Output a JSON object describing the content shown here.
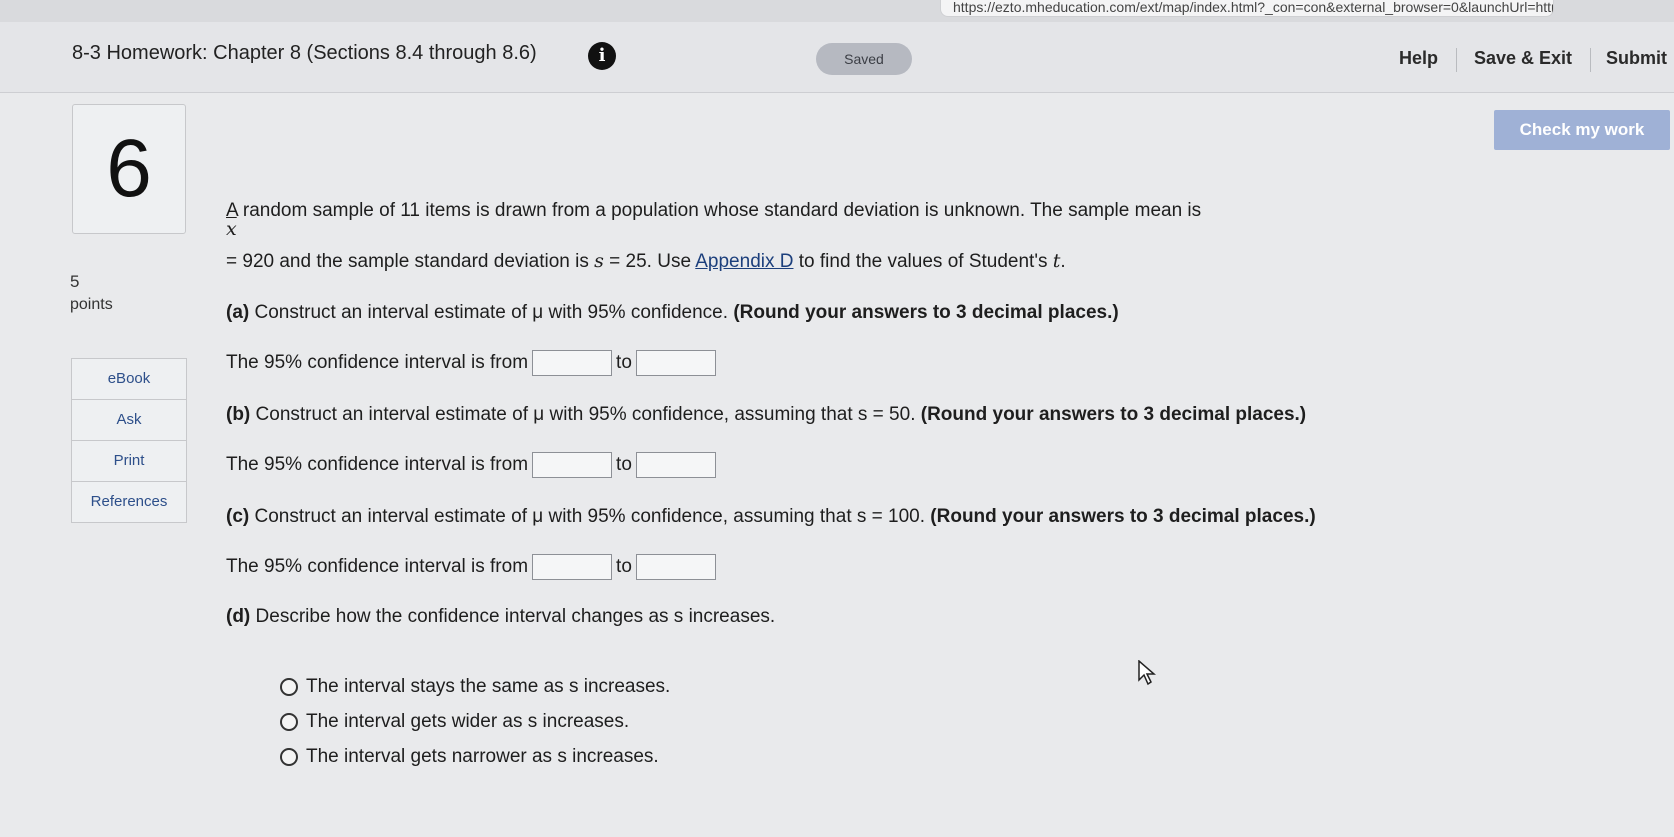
{
  "browser": {
    "url_fragment": "https://ezto.mheducation.com/ext/map/index.html?_con=con&external_browser=0&launchUrl=https%253A%252F%252Fnew..."
  },
  "header": {
    "title": "8-3 Homework: Chapter 8 (Sections 8.4 through 8.6)",
    "info_icon": "info-circle-icon",
    "status": "Saved",
    "help": "Help",
    "save_exit": "Save & Exit",
    "submit": "Submit"
  },
  "check_button": "Check my work",
  "question": {
    "number": "6",
    "points_value": "5",
    "points_label": "points",
    "nav": [
      "eBook",
      "Ask",
      "Print",
      "References"
    ],
    "intro_1": "A random sample of 11 items is drawn from a population whose standard deviation is unknown. The sample mean is",
    "xbar_symbol": "x",
    "intro_2a": "= 920 and the sample standard deviation is ",
    "s_symbol": "s",
    "intro_2b": " = 25. Use ",
    "appendix_link": "Appendix D",
    "intro_2c": " to find the values of Student's ",
    "t_symbol": "t",
    "intro_2d": ".",
    "parts": [
      {
        "label": "(a)",
        "text": " Construct an interval estimate of μ with 95% confidence. ",
        "instruction": "(Round your answers to 3 decimal places.)",
        "interval_prefix": "The 95% confidence interval is from",
        "interval_to": "to"
      },
      {
        "label": "(b)",
        "text": " Construct an interval estimate of μ with 95% confidence, assuming that s = 50. ",
        "instruction": "(Round your answers to 3 decimal places.)",
        "interval_prefix": "The 95% confidence interval is from",
        "interval_to": "to"
      },
      {
        "label": "(c)",
        "text": " Construct an interval estimate of μ with 95% confidence, assuming that s = 100. ",
        "instruction": "(Round your answers to 3 decimal places.)",
        "interval_prefix": "The 95% confidence interval is from",
        "interval_to": "to"
      }
    ],
    "part_d": {
      "label": "(d)",
      "text": " Describe how the confidence interval changes as s increases.",
      "options": [
        "The interval stays the same as s increases.",
        "The interval gets wider as s increases.",
        "The interval gets narrower as s increases."
      ]
    }
  }
}
